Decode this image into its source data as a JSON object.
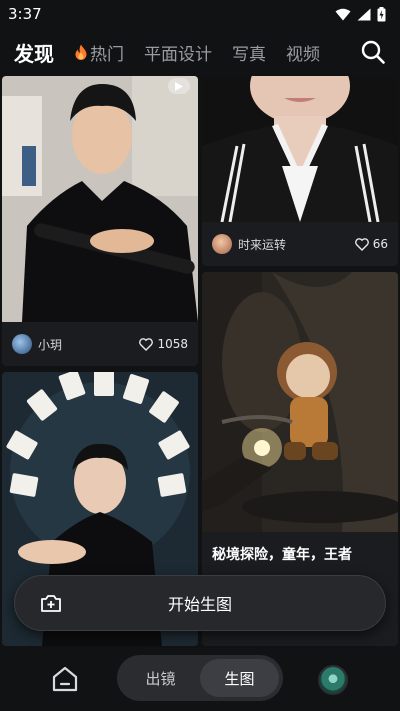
{
  "status_bar": {
    "time": "3:37"
  },
  "nav": {
    "tabs": [
      {
        "label": "发现"
      },
      {
        "label": "热门",
        "icon": "fire-icon"
      },
      {
        "label": "平面设计"
      },
      {
        "label": "写真"
      },
      {
        "label": "视频"
      }
    ]
  },
  "feed": {
    "cards": [
      {
        "author": "小玥",
        "likes": "1058"
      },
      {
        "author": "时来运转",
        "likes": "66"
      },
      {
        "title": "秘境探险，童年，王者"
      }
    ]
  },
  "start_button": {
    "label": "开始生图"
  },
  "bottom_bar": {
    "segments": [
      {
        "label": "出镜"
      },
      {
        "label": "生图"
      }
    ],
    "active_segment": "生图"
  },
  "colors": {
    "background": "#111214",
    "card": "#1b1c1f",
    "accent_fire": "#ff7a2a"
  }
}
